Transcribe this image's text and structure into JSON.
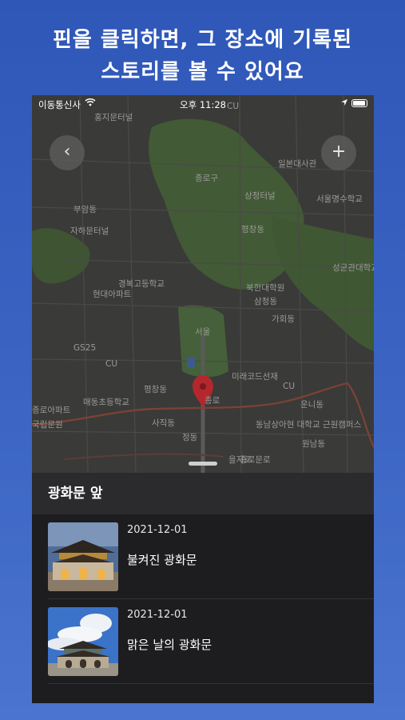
{
  "headline": {
    "line1": "핀을 클릭하면, 그 장소에 기록된",
    "line2": "스토리를 볼 수 있어요"
  },
  "statusbar": {
    "carrier": "이동통신사",
    "time": "오후 11:28"
  },
  "map": {
    "back_icon": "chevron-left-icon",
    "add_icon": "plus-icon",
    "labels": [
      "홍지문터널",
      "종로구",
      "일본대사관",
      "상정터널",
      "부암동",
      "서울명수학교",
      "자하문터널",
      "성균관대학교",
      "평창동",
      "경복고등학교",
      "현대아파트",
      "북한대학원",
      "삼청동",
      "가회동",
      "GS25",
      "CU",
      "CU",
      "서울",
      "미래코드선재",
      "매동초등학교",
      "종로",
      "운니동",
      "종로아파트",
      "국립문원",
      "동남상아현 대학교 근원캠퍼스",
      "종로문로",
      "사직동",
      "정동",
      "평창동",
      "원남동",
      "CU",
      "을지로"
    ],
    "colors": {
      "pin": "#b3272d",
      "park": "#425a35",
      "road": "#7a4236",
      "water": "#3d5a8a"
    }
  },
  "sheet": {
    "place_title": "광화문 앞",
    "stories": [
      {
        "date": "2021-12-01",
        "title": "불켜진 광화문",
        "thumb": "gate-night-photo"
      },
      {
        "date": "2021-12-01",
        "title": "맑은 날의 광화문",
        "thumb": "gate-day-photo"
      }
    ]
  }
}
